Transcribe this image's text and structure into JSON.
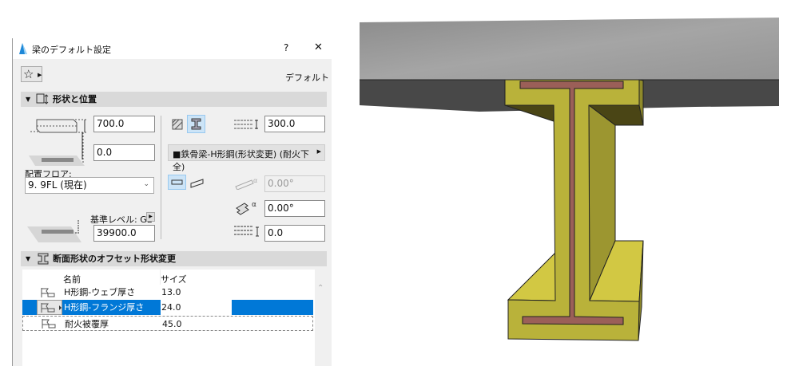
{
  "dialog": {
    "title": "梁のデフォルト設定",
    "help_label": "?",
    "close_label": "✕",
    "favorites_label": "☆",
    "preset_label": "デフォルト",
    "section_shape": {
      "title": "形状と位置",
      "height_value": "700.0",
      "offset_value": "0.0",
      "floor_label": "配置フロア:",
      "floor_value": "9. 9FL (現在)",
      "ref_level_label": "基準レベル: GL",
      "ref_level_value": "39900.0",
      "width_value": "300.0",
      "profile_value": "■鉄骨梁-H形鋼(形状変更) (耐火下全)",
      "slant_value": "0.00°",
      "rotation_value": "0.00°",
      "offset2_value": "0.0"
    },
    "section_offset": {
      "title": "断面形状のオフセット形状変更",
      "columns": [
        "名前",
        "サイズ"
      ],
      "rows": [
        {
          "name": "H形鋼-ウェブ厚さ",
          "size": "13.0"
        },
        {
          "name": "H形鋼-フランジ厚さ",
          "size": "24.0"
        },
        {
          "name": "耐火被覆厚",
          "size": "45.0"
        }
      ],
      "selected_index": 1
    }
  },
  "colors": {
    "accent": "#0078d7",
    "coating": "#c8c23a",
    "steel": "#9b5f58",
    "slab": "#9a9a9a"
  }
}
